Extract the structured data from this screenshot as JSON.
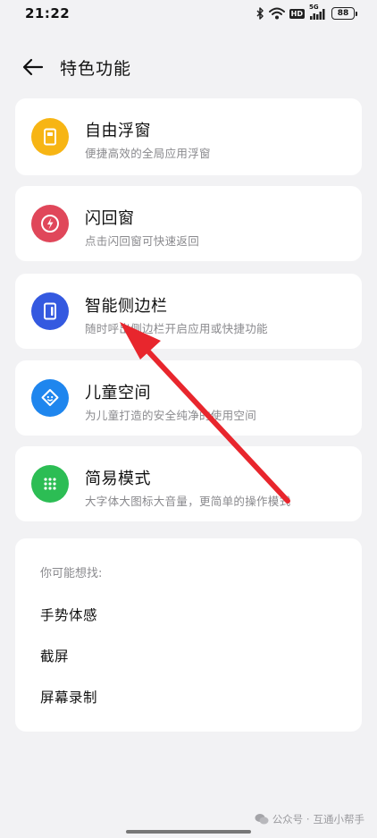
{
  "status_bar": {
    "time": "21:22",
    "signal_tag": "5G",
    "hd_badge": "HD",
    "battery": "88",
    "icons": [
      "bluetooth-icon",
      "wifi-icon",
      "hd-icon",
      "signal-icon",
      "battery-icon"
    ]
  },
  "header": {
    "title": "特色功能",
    "back_icon": "arrow-left-icon"
  },
  "features": [
    {
      "title": "自由浮窗",
      "subtitle": "便捷高效的全局应用浮窗",
      "icon": "floating-window-icon",
      "color": "#f7b514"
    },
    {
      "title": "闪回窗",
      "subtitle": "点击闪回窗可快速返回",
      "icon": "flashback-icon",
      "color": "#e0475a"
    },
    {
      "title": "智能侧边栏",
      "subtitle": "随时呼出侧边栏开启应用或快捷功能",
      "icon": "sidebar-icon",
      "color": "#3459e0"
    },
    {
      "title": "儿童空间",
      "subtitle": "为儿童打造的安全纯净的使用空间",
      "icon": "kids-space-icon",
      "color": "#1f86ee"
    },
    {
      "title": "简易模式",
      "subtitle": "大字体大图标大音量，更简单的操作模式",
      "icon": "grid-dots-icon",
      "color": "#2cbd54"
    }
  ],
  "suggestions": {
    "label": "你可能想找:",
    "items": [
      "手势体感",
      "截屏",
      "屏幕录制"
    ]
  },
  "annotation": {
    "color": "#e8262d"
  },
  "watermark": {
    "prefix": "公众号 ·",
    "name": "互通小帮手"
  }
}
